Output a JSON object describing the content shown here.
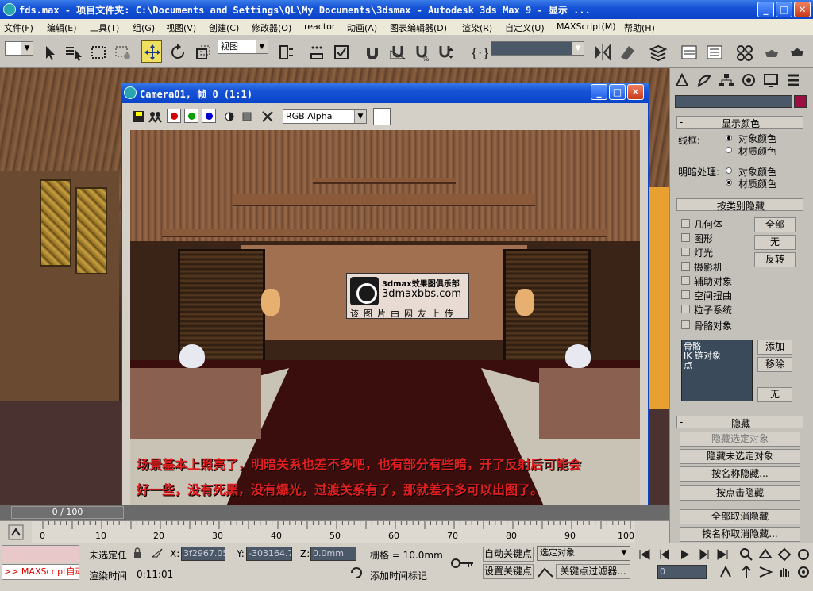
{
  "window": {
    "title": "fds.max      - 项目文件夹: C:\\Documents and Settings\\QL\\My Documents\\3dsmax      - Autodesk 3ds Max 9   - 显示 ...",
    "min": "_",
    "max": "□",
    "close": "✕"
  },
  "menu": [
    "文件(F)",
    "编辑(E)",
    "工具(T)",
    "组(G)",
    "视图(V)",
    "创建(C)",
    "修改器(O)",
    "reactor",
    "动画(A)",
    "图表编辑器(D)",
    "渲染(R)",
    "自定义(U)",
    "MAXScript(M)",
    "帮助(H)"
  ],
  "toolbar": {
    "view_combo": "视图",
    "selection_set": ""
  },
  "render_window": {
    "title": "Camera01, 帧 0 (1:1)",
    "channel": "RGB Alpha",
    "watermark": {
      "line1": "3dmax效果图俱乐部",
      "line2": "3dmaxbbs.com",
      "line3": "该图片由网友上传"
    },
    "caption_line1": "场景基本上照亮了，明暗关系也差不多吧，也有部分有些暗，开了反射后可能会",
    "caption_line2": "好一些，没有死黑，没有爆光，过渡关系有了，那就差不多可以出图了。"
  },
  "command_panel": {
    "display_color_header": "显示颜色",
    "wireframe_label": "线框:",
    "shaded_label": "明暗处理:",
    "object_color": "对象颜色",
    "material_color": "材质颜色",
    "hide_by_category_header": "按类别隐藏",
    "categories": [
      "几何体",
      "图形",
      "灯光",
      "摄影机",
      "辅助对象",
      "空间扭曲",
      "粒子系统",
      "骨骼对象"
    ],
    "btn_all": "全部",
    "btn_none": "无",
    "btn_invert": "反转",
    "list_items": [
      "骨骼",
      "IK 链对象",
      "点"
    ],
    "btn_add": "添加",
    "btn_remove": "移除",
    "btn_none2": "无",
    "hide_header": "隐藏",
    "hide_buttons": [
      "隐藏选定对象",
      "隐藏未选定对象",
      "按名称隐藏...",
      "按点击隐藏",
      "全部取消隐藏",
      "按名称取消隐藏..."
    ]
  },
  "timeline": {
    "slider_label": "0 / 100",
    "ticks": [
      "0",
      "10",
      "20",
      "30",
      "40",
      "50",
      "60",
      "70",
      "80",
      "90",
      "100"
    ]
  },
  "status": {
    "maxscript_label": ">> MAXScript自动",
    "selection": "未选定任",
    "x_label": "X:",
    "x_value": "3f2967.05",
    "y_label": "Y:",
    "y_value": "-303164.7",
    "z_label": "Z:",
    "z_value": "0.0mm",
    "grid": "栅格 = 10.0mm",
    "auto_key": "自动关键点",
    "set_key": "设置关键点",
    "key_mode": "选定对象",
    "key_filters": "关键点过滤器...",
    "render_time_label": "渲染时间",
    "render_time": "0:11:01",
    "add_time_tag": "添加时间标记",
    "frame": "0"
  }
}
